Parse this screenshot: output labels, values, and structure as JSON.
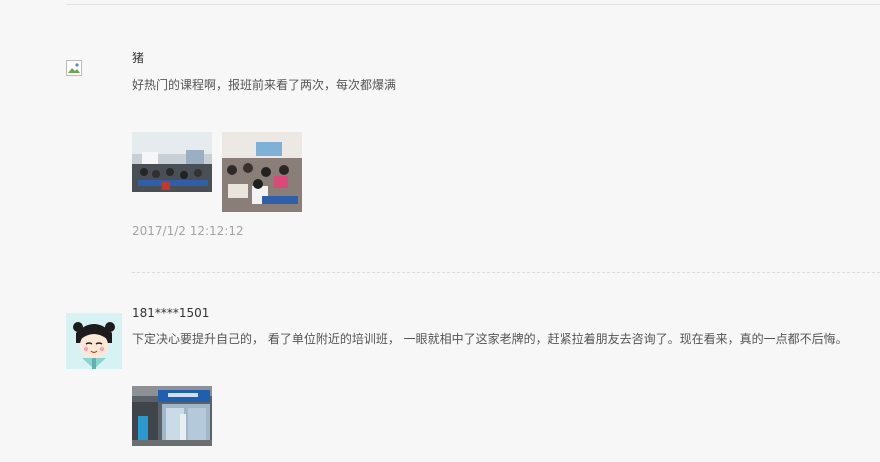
{
  "comments": [
    {
      "username": "猪",
      "text": "好热门的课程啊，报班前来看了两次，每次都爆满",
      "timestamp": "2017/1/2 12:12:12"
    },
    {
      "username": "181****1501",
      "text": "下定决心要提升自己的， 看了单位附近的培训班， 一眼就相中了这家老牌的，赶紧拉着朋友去咨询了。现在看来，真的一点都不后悔。"
    }
  ]
}
